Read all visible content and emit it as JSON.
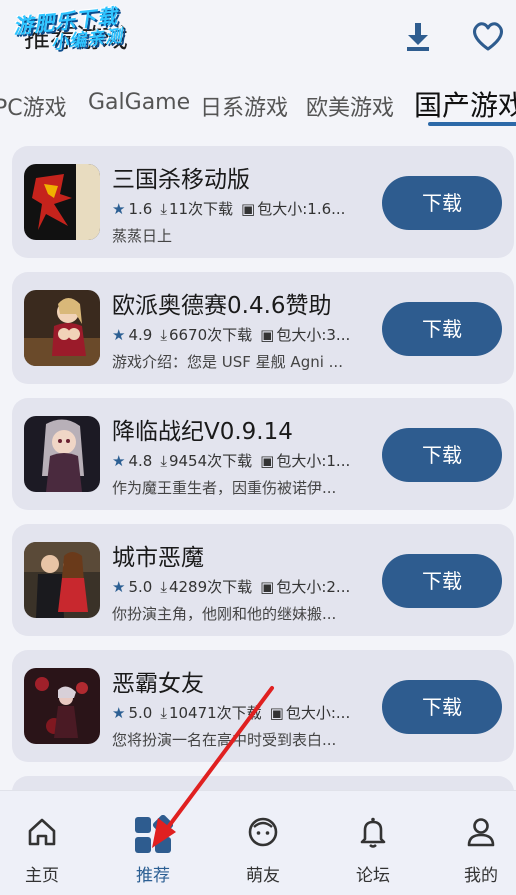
{
  "watermark": {
    "line1": "游肥乐下载",
    "line2": "小编亲测"
  },
  "header": {
    "title": "推荐游戏"
  },
  "tabs": [
    {
      "label": "PC游戏"
    },
    {
      "label": "GalGame"
    },
    {
      "label": "日系游戏"
    },
    {
      "label": "欧美游戏"
    },
    {
      "label": "国产游戏"
    }
  ],
  "games": [
    {
      "name": "三国杀移动版",
      "rating": "1.6",
      "downloads": "11次下载",
      "size": "包大小:1.6...",
      "desc": "蒸蒸日上",
      "button": "下载"
    },
    {
      "name": "欧派奥德赛0.4.6赞助",
      "rating": "4.9",
      "downloads": "6670次下载",
      "size": "包大小:3...",
      "desc": "游戏介绍：您是 USF 星舰 Agni ...",
      "button": "下载"
    },
    {
      "name": "降临战纪V0.9.14",
      "rating": "4.8",
      "downloads": "9454次下载",
      "size": "包大小:1...",
      "desc": "作为魔王重生者，因重伤被诺伊...",
      "button": "下载"
    },
    {
      "name": "城市恶魔",
      "rating": "5.0",
      "downloads": "4289次下载",
      "size": "包大小:2...",
      "desc": "你扮演主角，他刚和他的继妹搬...",
      "button": "下载"
    },
    {
      "name": "恶霸女友",
      "rating": "5.0",
      "downloads": "10471次下载",
      "size": "包大小:...",
      "desc": "您将扮演一名在高中时受到表白...",
      "button": "下载"
    }
  ],
  "nav": [
    {
      "label": "主页",
      "icon": "home-icon"
    },
    {
      "label": "推荐",
      "icon": "grid-icon"
    },
    {
      "label": "萌友",
      "icon": "face-icon"
    },
    {
      "label": "论坛",
      "icon": "bell-icon"
    },
    {
      "label": "我的",
      "icon": "person-icon"
    }
  ],
  "colors": {
    "accent": "#2e5c8f",
    "card_bg": "#e3e4ee",
    "page_bg": "#f3f4f9",
    "arrow": "#e02020"
  }
}
